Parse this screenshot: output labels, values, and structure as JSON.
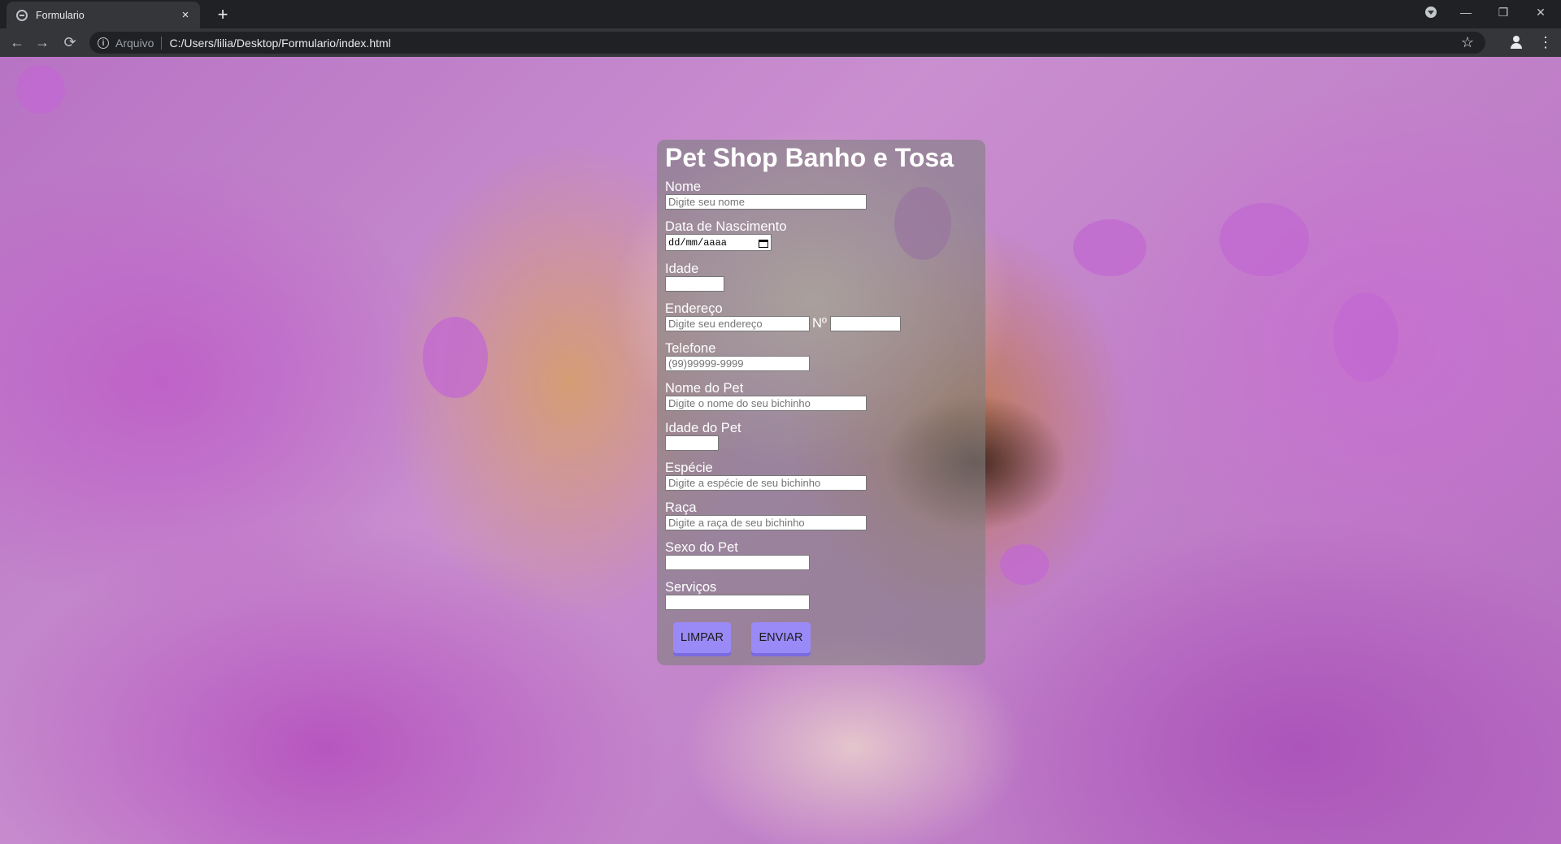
{
  "browser": {
    "tab_title": "Formulario",
    "tab_close": "×",
    "new_tab": "+",
    "scheme_label": "Arquivo",
    "url": "C:/Users/lilia/Desktop/Formulario/index.html",
    "back": "←",
    "forward": "→",
    "reload": "⟳",
    "bookmark": "☆",
    "menu": "⋮",
    "minimize": "—",
    "restore": "❐",
    "close": "✕"
  },
  "form": {
    "title": "Pet Shop Banho e Tosa",
    "fields": {
      "nome": {
        "label": "Nome",
        "placeholder": "Digite seu nome"
      },
      "nascimento": {
        "label": "Data de Nascimento",
        "value": "dd/mm/aaaa"
      },
      "idade": {
        "label": "Idade"
      },
      "endereco": {
        "label": "Endereço",
        "placeholder": "Digite seu endereço"
      },
      "numero": {
        "label": "Nº"
      },
      "telefone": {
        "label": "Telefone",
        "placeholder": "(99)99999-9999"
      },
      "nome_pet": {
        "label": "Nome do Pet",
        "placeholder": "Digite o nome do seu bichinho"
      },
      "idade_pet": {
        "label": "Idade do Pet"
      },
      "especie": {
        "label": "Espécie",
        "placeholder": "Digite a espécie de seu bichinho"
      },
      "raca": {
        "label": "Raça",
        "placeholder": "Digite a raça de seu bichinho"
      },
      "sexo_pet": {
        "label": "Sexo do Pet"
      },
      "servicos": {
        "label": "Serviços"
      }
    },
    "buttons": {
      "limpar": "LIMPAR",
      "enviar": "ENVIAR"
    },
    "colors": {
      "button_bg": "#9a8af7",
      "card_bg": "rgba(128,128,128,0.62)"
    }
  }
}
